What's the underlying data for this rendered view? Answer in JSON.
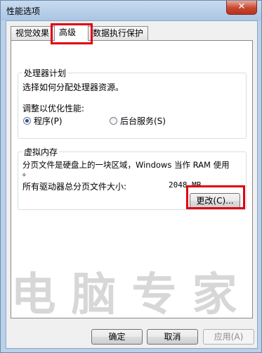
{
  "window": {
    "title": "性能选项",
    "close_glyph": "✕"
  },
  "tabs": [
    {
      "label": "视觉效果"
    },
    {
      "label": "高级"
    },
    {
      "label": "数据执行保护"
    }
  ],
  "processor": {
    "group_title": "处理器计划",
    "description": "选择如何分配处理器资源。",
    "adjust_label": "调整以优化性能:",
    "options": [
      {
        "label": "程序(P)",
        "selected": true
      },
      {
        "label": "后台服务(S)",
        "selected": false
      }
    ]
  },
  "virtual_memory": {
    "group_title": "虚拟内存",
    "description_line1": "分页文件是硬盘上的一块区域，Windows 当作 RAM 使用",
    "description_line2": "。",
    "total_label": "所有驱动器总分页文件大小:",
    "total_value": "2048 MB",
    "change_button": "更改(C)..."
  },
  "footer": {
    "ok": "确定",
    "cancel": "取消",
    "apply": "应用(A)"
  },
  "watermark": "电脑专家",
  "colors": {
    "highlight_box": "#e0000f",
    "radio_selected": "#2452a5"
  }
}
